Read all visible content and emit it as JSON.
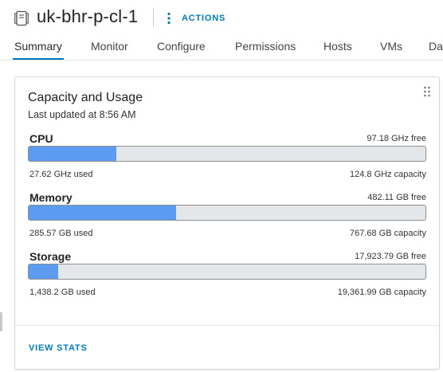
{
  "header": {
    "title": "uk-bhr-p-cl-1",
    "actions_label": "ACTIONS",
    "icon": "cluster-icon",
    "accent_color": "#0079b8"
  },
  "tabs": [
    {
      "label": "Summary",
      "active": true
    },
    {
      "label": "Monitor",
      "active": false
    },
    {
      "label": "Configure",
      "active": false
    },
    {
      "label": "Permissions",
      "active": false
    },
    {
      "label": "Hosts",
      "active": false
    },
    {
      "label": "VMs",
      "active": false
    },
    {
      "label": "Da",
      "active": false
    }
  ],
  "card": {
    "title": "Capacity and Usage",
    "last_updated": "Last updated at 8:56 AM",
    "view_stats_label": "VIEW STATS",
    "bar_fill_color": "#5b9cf0",
    "bar_track_color": "#e4e7e9",
    "metrics": [
      {
        "name": "CPU",
        "free": "97.18 GHz free",
        "used": "27.62 GHz used",
        "capacity": "124.8 GHz capacity",
        "used_fraction": 0.2213
      },
      {
        "name": "Memory",
        "free": "482.11 GB free",
        "used": "285.57 GB used",
        "capacity": "767.68 GB capacity",
        "used_fraction": 0.372
      },
      {
        "name": "Storage",
        "free": "17,923.79 GB free",
        "used": "1,438.2 GB used",
        "capacity": "19,361.99 GB capacity",
        "used_fraction": 0.0743
      }
    ]
  }
}
